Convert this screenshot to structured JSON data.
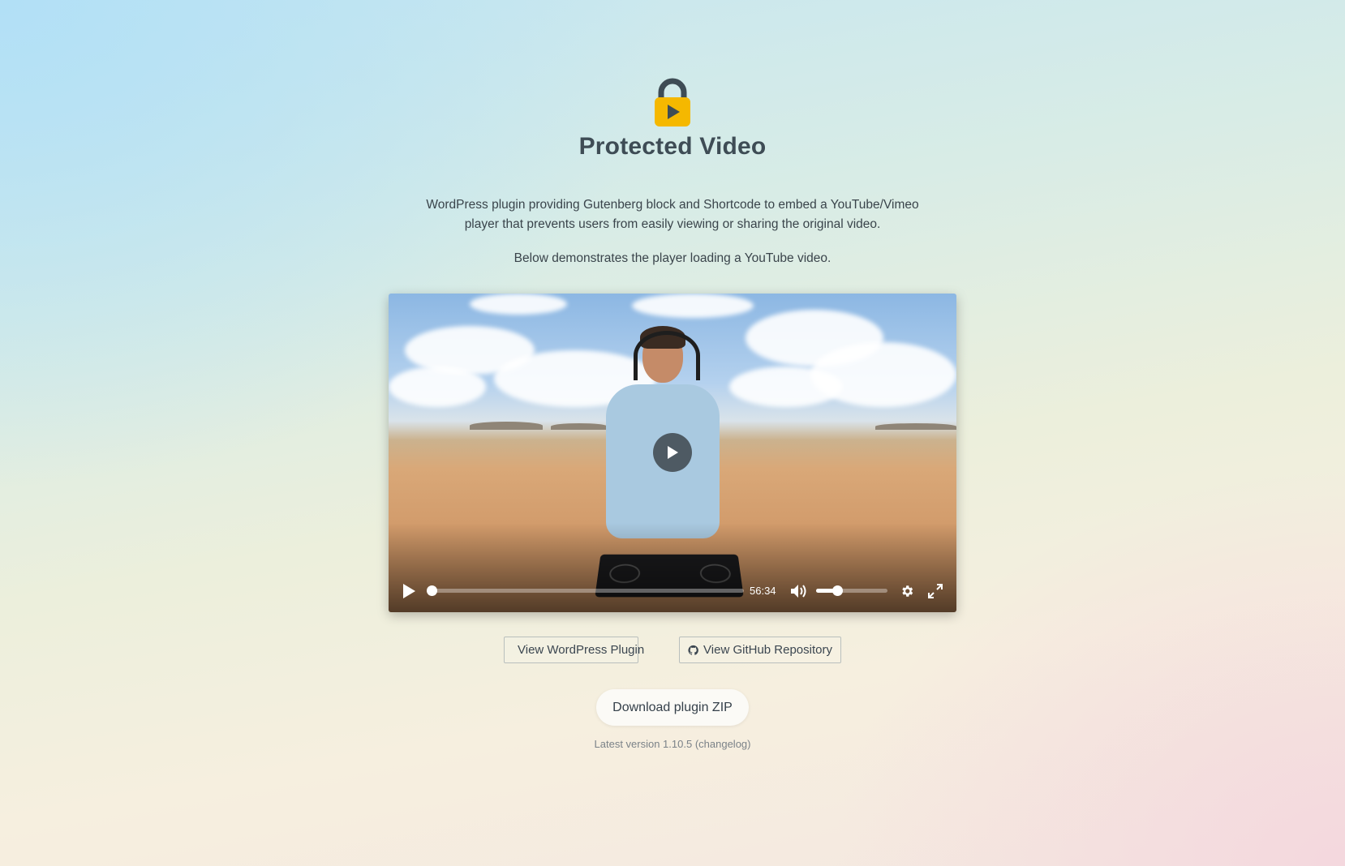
{
  "header": {
    "logo_icon": "lock-play-icon",
    "title": "Protected Video"
  },
  "intro": {
    "description": "WordPress plugin providing Gutenberg block and Shortcode to embed a YouTube/Vimeo player that prevents users from easily viewing or sharing the original video.",
    "demo_note": "Below demonstrates the player loading a YouTube video."
  },
  "player": {
    "duration": "56:34",
    "progress": 0,
    "volume": 0.3,
    "icons": {
      "big_play": "play-icon",
      "play": "play-icon",
      "mute": "volume-icon",
      "settings": "gear-icon",
      "fullscreen": "fullscreen-icon"
    }
  },
  "links": {
    "wordpress_label": "View WordPress Plugin",
    "wordpress_icon": "wordpress-icon",
    "github_label": "View GitHub Repository",
    "github_icon": "github-icon"
  },
  "download": {
    "label": "Download plugin ZIP",
    "version_prefix": "Latest version 1.10.5 ",
    "changelog_label": "(changelog)"
  },
  "colors": {
    "logo_lock": "#3e4c55",
    "logo_body": "#f5b800",
    "title": "#3e4c55"
  }
}
